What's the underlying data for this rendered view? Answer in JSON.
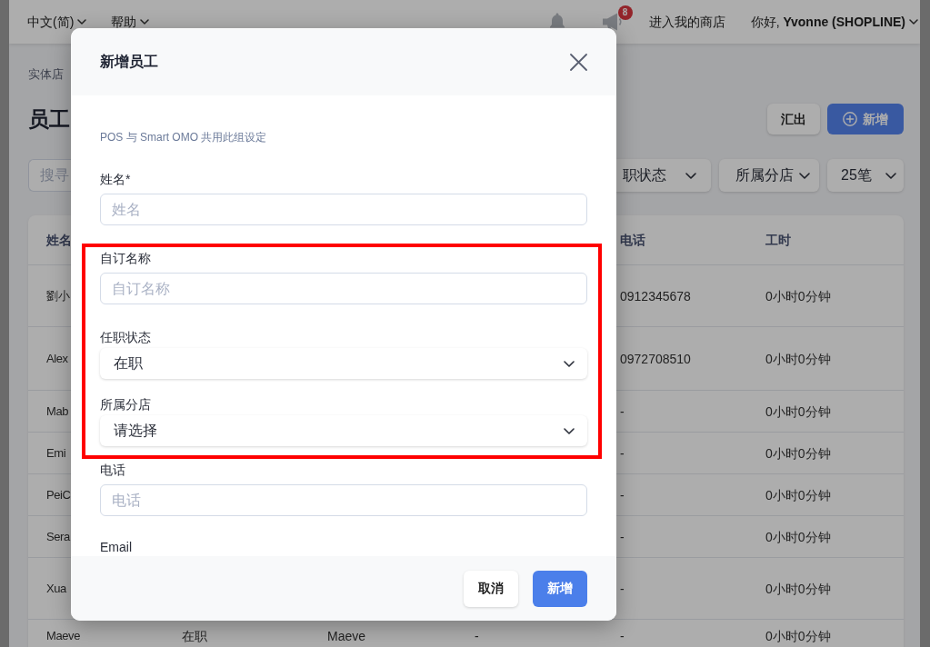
{
  "top_bar": {
    "menus": [
      "中文(简)",
      "帮助"
    ],
    "icons": [
      {
        "kind": "bell"
      },
      {
        "kind": "megaphone",
        "badge": "8"
      }
    ],
    "store_link": "进入我的商店",
    "user_menu": "你好, **Yvonne (SHOPLINE)**"
  },
  "page": {
    "breadcrumb": "实体店",
    "title": "员工",
    "actions": [
      {
        "kind": "secondary",
        "label": "汇出"
      },
      {
        "kind": "primary",
        "label": "新增"
      }
    ],
    "search": {
      "placeholder": "搜寻"
    },
    "filters": [
      "职状态",
      "所属分店",
      "25笔"
    ]
  },
  "table": {
    "columns": [
      "姓名",
      null,
      null,
      null,
      "电话",
      "工时"
    ],
    "rows": [
      {
        "cells": [
          "劉小",
          null,
          null,
          null,
          "0912345678",
          "0小时0分钟"
        ]
      },
      {
        "cells": [
          "Alex",
          null,
          null,
          null,
          "0972708510",
          "0小时0分钟"
        ]
      },
      {
        "cells": [
          "Mab",
          null,
          null,
          null,
          "-",
          "0小时0分钟"
        ]
      },
      {
        "cells": [
          "Emi",
          null,
          null,
          null,
          "-",
          "0小时0分钟"
        ]
      },
      {
        "cells": [
          "PeiC",
          null,
          null,
          null,
          "-",
          "0小时0分钟"
        ]
      },
      {
        "cells": [
          "Sera",
          null,
          null,
          null,
          "-",
          "0小时0分钟"
        ]
      },
      {
        "cells": [
          "Xua",
          null,
          null,
          null,
          "-",
          "0小时0分钟"
        ]
      },
      {
        "cells": [
          "Maeve",
          "在职",
          "Maeve",
          "-",
          "-",
          "0小时0分钟"
        ]
      }
    ]
  },
  "dialog": {
    "title": "新增员工",
    "note": "POS 与 Smart OMO 共用此组设定",
    "fields": [
      {
        "kind": "text",
        "label": "姓名*",
        "placeholder": "姓名",
        "highlighted": false
      },
      {
        "kind": "text",
        "label": "自订名称",
        "placeholder": "自订名称",
        "highlighted": true
      },
      {
        "kind": "select",
        "label": "任职状态",
        "value": "在职",
        "highlighted": true
      },
      {
        "kind": "select",
        "label": "所属分店",
        "value": "请选择",
        "highlighted": true
      },
      {
        "kind": "text",
        "label": "电话",
        "placeholder": "电话",
        "highlighted": false
      },
      {
        "kind": "text",
        "label": "Email",
        "highlighted": false
      }
    ],
    "buttons": [
      {
        "kind": "secondary",
        "label": "取消"
      },
      {
        "kind": "primary",
        "label": "新增"
      }
    ]
  }
}
